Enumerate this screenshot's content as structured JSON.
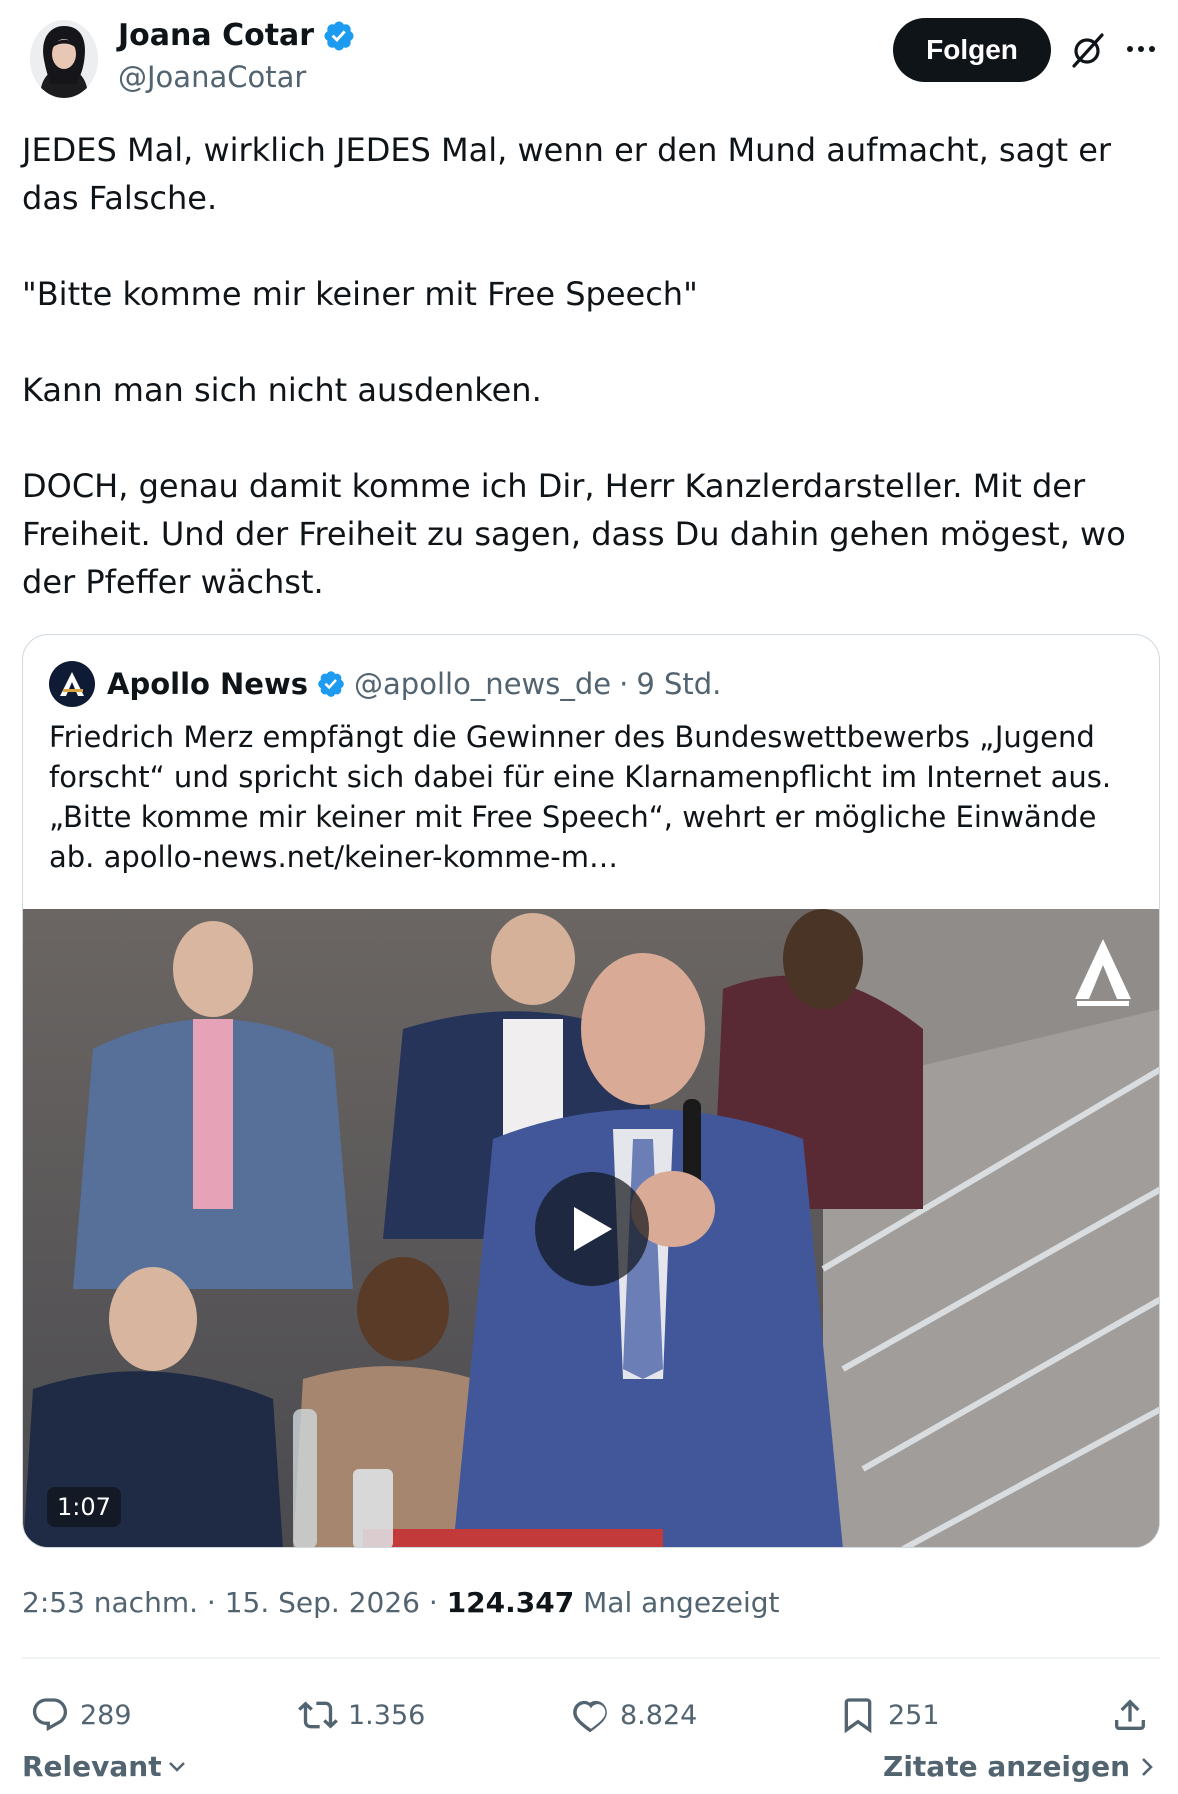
{
  "author": {
    "display_name": "Joana Cotar",
    "handle": "@JoanaCotar",
    "verified": true,
    "avatar_icon": "profile-photo"
  },
  "header": {
    "follow_label": "Folgen",
    "grok_icon": "slashed-circle-icon",
    "more_icon": "ellipsis-icon"
  },
  "tweet": {
    "paragraphs": [
      "JEDES Mal, wirklich JEDES Mal, wenn er den Mund aufmacht, sagt er das Falsche.",
      "\"Bitte komme mir keiner mit Free Speech\"",
      "Kann man sich nicht ausdenken.",
      "DOCH, genau damit komme ich Dir, Herr Kanzlerdarsteller. Mit der Freiheit. Und der Freiheit zu sagen, dass Du dahin gehen mögest, wo der Pfeffer wächst."
    ]
  },
  "quote": {
    "display_name": "Apollo News",
    "handle": "@apollo_news_de",
    "separator": "·",
    "time": "9 Std.",
    "text": "Friedrich Merz empfängt die Gewinner des Bundeswettbewerbs „Jugend forscht“ und spricht sich dabei für eine Klarnamenpflicht im Internet aus. „Bitte komme mir keiner mit Free Speech“, wehrt er mögliche Einwände ab. apollo-news.net/keiner-komme-m…",
    "video_duration": "1:07"
  },
  "meta": {
    "time": "2:53 nachm.",
    "separator": "·",
    "date": "15. Sep. 2026",
    "views_count": "124.347",
    "views_label": "Mal angezeigt"
  },
  "actions": {
    "replies": "289",
    "reposts": "1.356",
    "likes": "8.824",
    "bookmarks": "251"
  },
  "footer": {
    "sort_label": "Relevant",
    "quotes_label": "Zitate anzeigen"
  },
  "colors": {
    "text_primary": "#0f1419",
    "text_secondary": "#536471",
    "verified_blue": "#1d9bf0",
    "border": "#cfd9de"
  }
}
